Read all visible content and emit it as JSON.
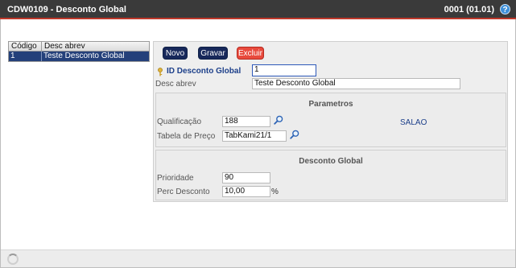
{
  "window": {
    "title": "CDW0109 - Desconto Global",
    "version": "0001 (01.01)",
    "help_glyph": "?"
  },
  "grid": {
    "columns": [
      "Código",
      "Desc abrev"
    ],
    "rows": [
      {
        "codigo": "1",
        "desc": "Teste Desconto Global",
        "selected": true
      }
    ]
  },
  "toolbar": {
    "novo_label": "Novo",
    "gravar_label": "Gravar",
    "excluir_label": "Excluir"
  },
  "form": {
    "id_label": "ID Desconto Global",
    "id_value": "1",
    "desc_label": "Desc abrev",
    "desc_value": "Teste Desconto Global",
    "parametros": {
      "title": "Parametros",
      "qualificacao_label": "Qualificação",
      "qualificacao_value": "188",
      "qualificacao_desc": "SALAO",
      "tabela_label": "Tabela de Preço",
      "tabela_value": "TabKami21/1"
    },
    "desconto": {
      "title": "Desconto Global",
      "prioridade_label": "Prioridade",
      "prioridade_value": "90",
      "perc_label": "Perc Desconto",
      "perc_value": "10,00",
      "perc_unit": "%"
    }
  },
  "colors": {
    "titlebar_bg": "#3a3a3a",
    "accent_red": "#c0392b",
    "button_dark": "#17285a",
    "button_danger": "#e84a3d",
    "selected_row": "#24407a",
    "label_blue": "#1c3f8a"
  },
  "icons": {
    "key": "key-icon",
    "lookup": "search-icon",
    "help": "help-icon",
    "loading": "spinner-icon"
  }
}
